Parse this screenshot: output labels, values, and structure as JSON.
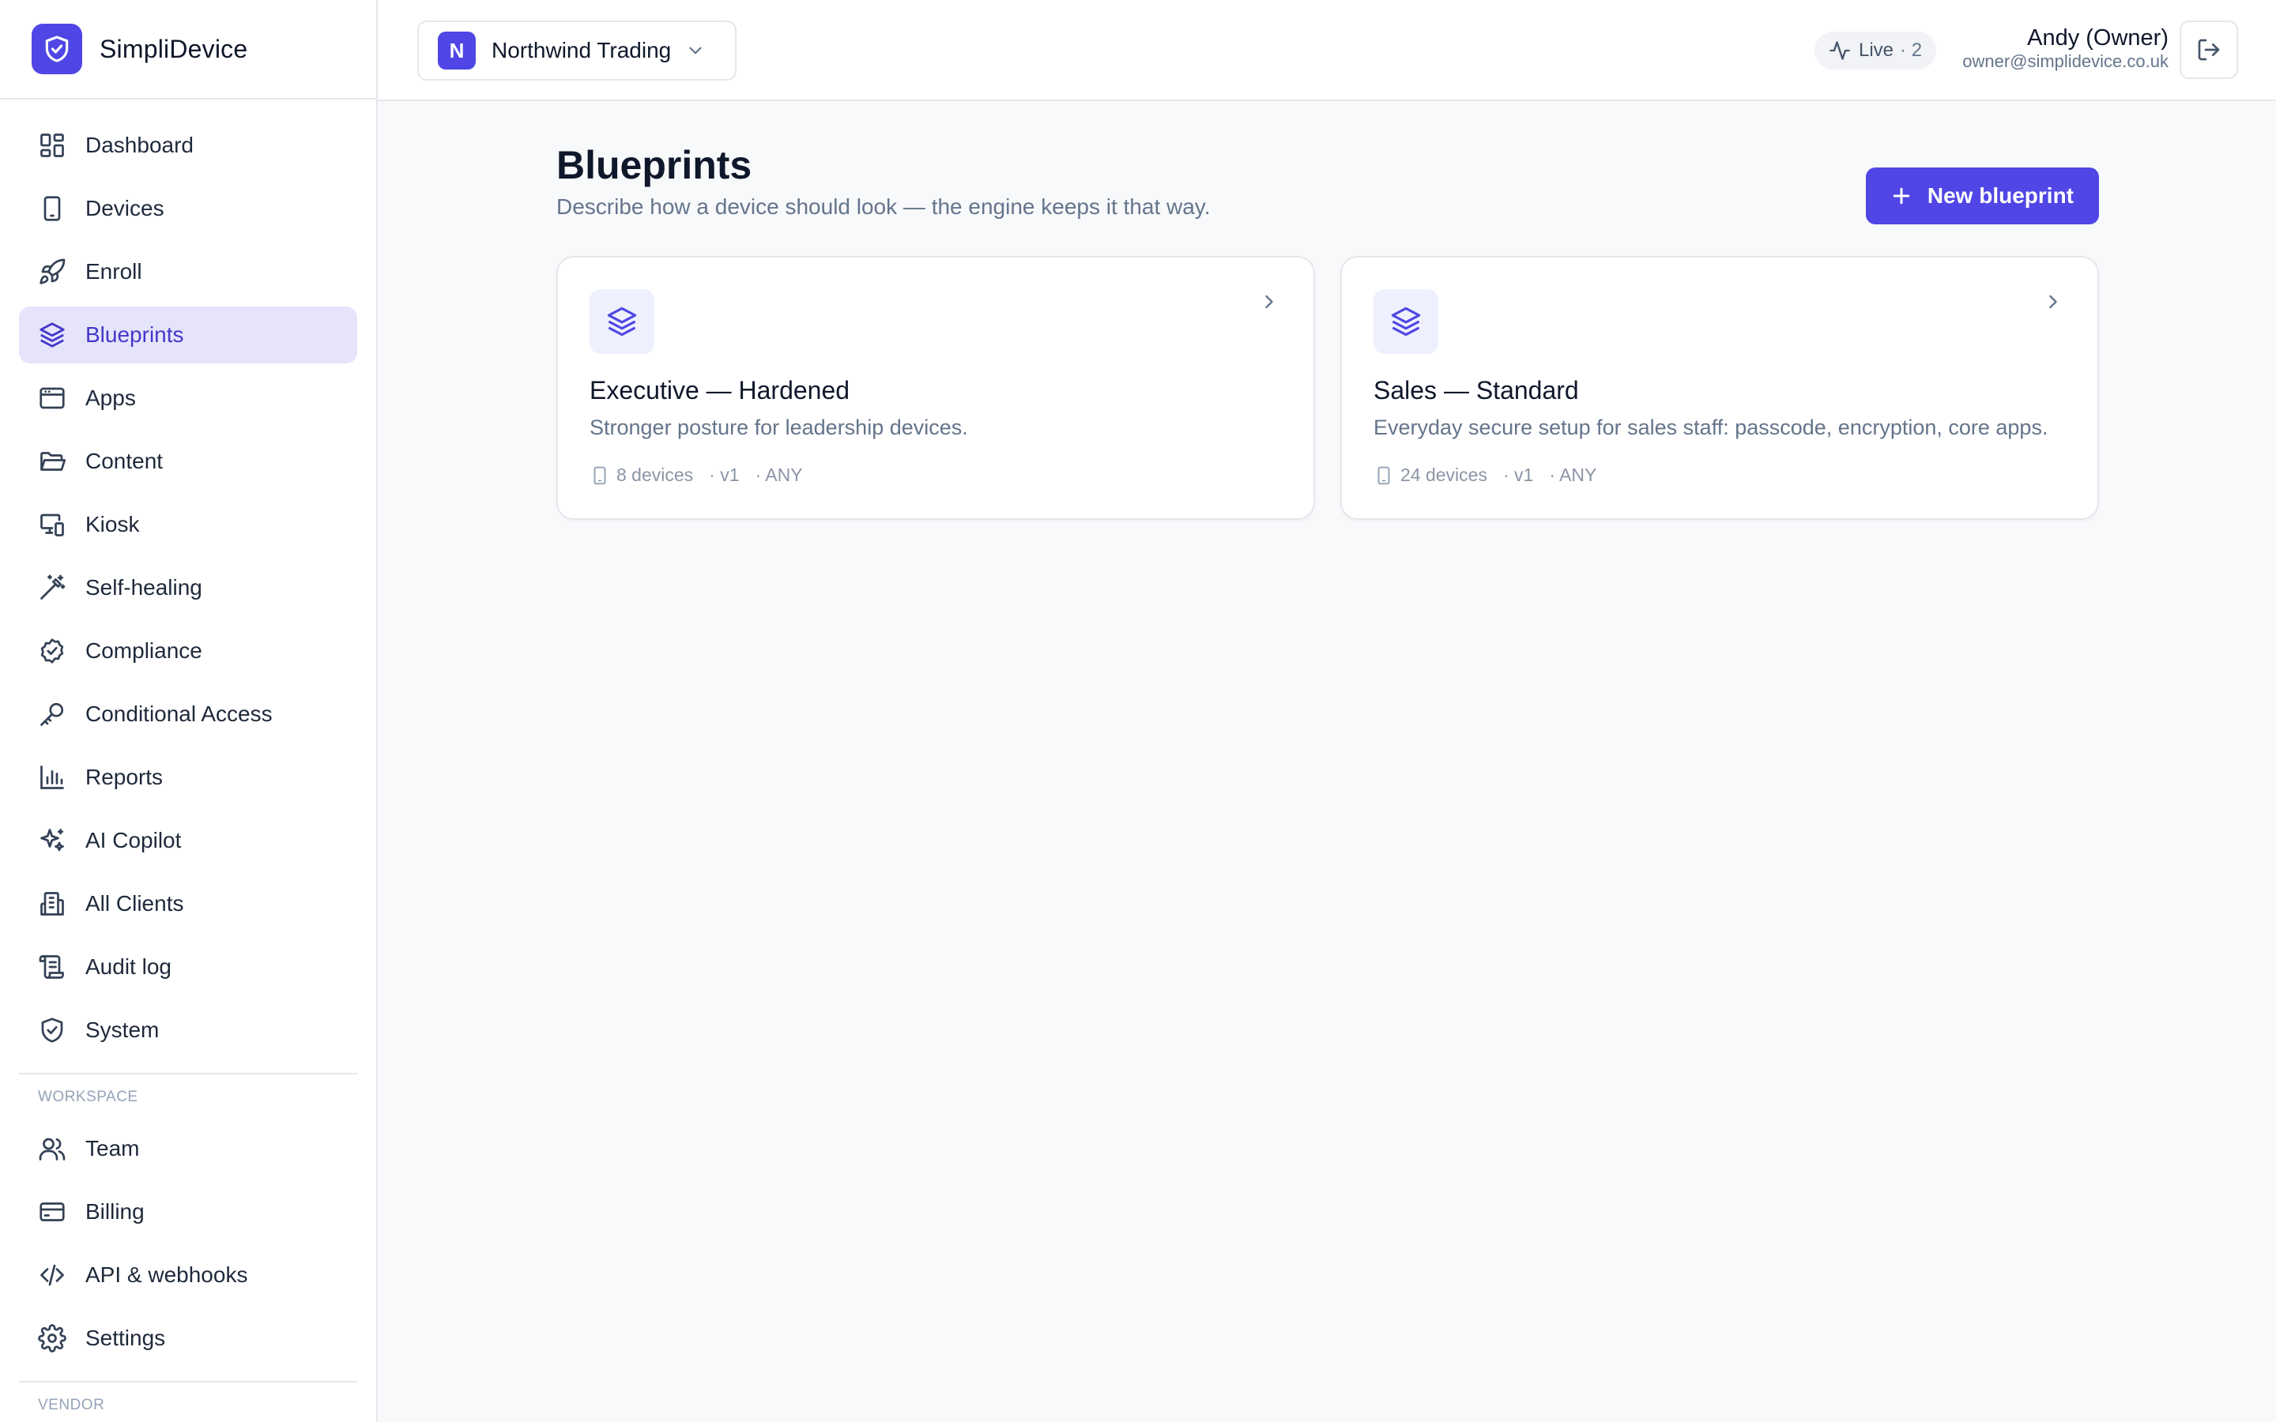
{
  "brand": {
    "name": "SimpliDevice"
  },
  "sidebar": {
    "items": [
      {
        "label": "Dashboard",
        "icon": "dashboard-icon"
      },
      {
        "label": "Devices",
        "icon": "device-icon"
      },
      {
        "label": "Enroll",
        "icon": "rocket-icon"
      },
      {
        "label": "Blueprints",
        "icon": "layers-icon",
        "active": true
      },
      {
        "label": "Apps",
        "icon": "app-window-icon"
      },
      {
        "label": "Content",
        "icon": "folder-icon"
      },
      {
        "label": "Kiosk",
        "icon": "kiosk-icon"
      },
      {
        "label": "Self-healing",
        "icon": "magic-wand-icon"
      },
      {
        "label": "Compliance",
        "icon": "check-badge-icon"
      },
      {
        "label": "Conditional Access",
        "icon": "key-icon"
      },
      {
        "label": "Reports",
        "icon": "bar-chart-icon"
      },
      {
        "label": "AI Copilot",
        "icon": "sparkles-icon"
      },
      {
        "label": "All Clients",
        "icon": "building-icon"
      },
      {
        "label": "Audit log",
        "icon": "scroll-icon"
      },
      {
        "label": "System",
        "icon": "shield-check-icon"
      }
    ],
    "workspace_label": "WORKSPACE",
    "workspace_items": [
      {
        "label": "Team",
        "icon": "users-icon"
      },
      {
        "label": "Billing",
        "icon": "credit-card-icon"
      },
      {
        "label": "API & webhooks",
        "icon": "code-icon"
      },
      {
        "label": "Settings",
        "icon": "gear-icon"
      }
    ],
    "vendor_label": "VENDOR"
  },
  "topbar": {
    "org_initial": "N",
    "org_name": "Northwind Trading",
    "live_label": "Live",
    "live_count": "· 2",
    "user_name": "Andy (Owner)",
    "user_email": "owner@simplidevice.co.uk"
  },
  "main": {
    "title": "Blueprints",
    "subtitle": "Describe how a device should look — the engine keeps it that way.",
    "new_button": "New blueprint",
    "cards": [
      {
        "title": "Executive — Hardened",
        "description": "Stronger posture for leadership devices.",
        "devices": "8 devices",
        "version": "· v1",
        "platform": "· ANY"
      },
      {
        "title": "Sales — Standard",
        "description": "Everyday secure setup for sales staff: passcode, encryption, core apps.",
        "devices": "24 devices",
        "version": "· v1",
        "platform": "· ANY"
      }
    ]
  },
  "colors": {
    "accent": "#4f46e5",
    "active_nav_bg": "#e6e4fb",
    "background": "#f8f9fb"
  }
}
